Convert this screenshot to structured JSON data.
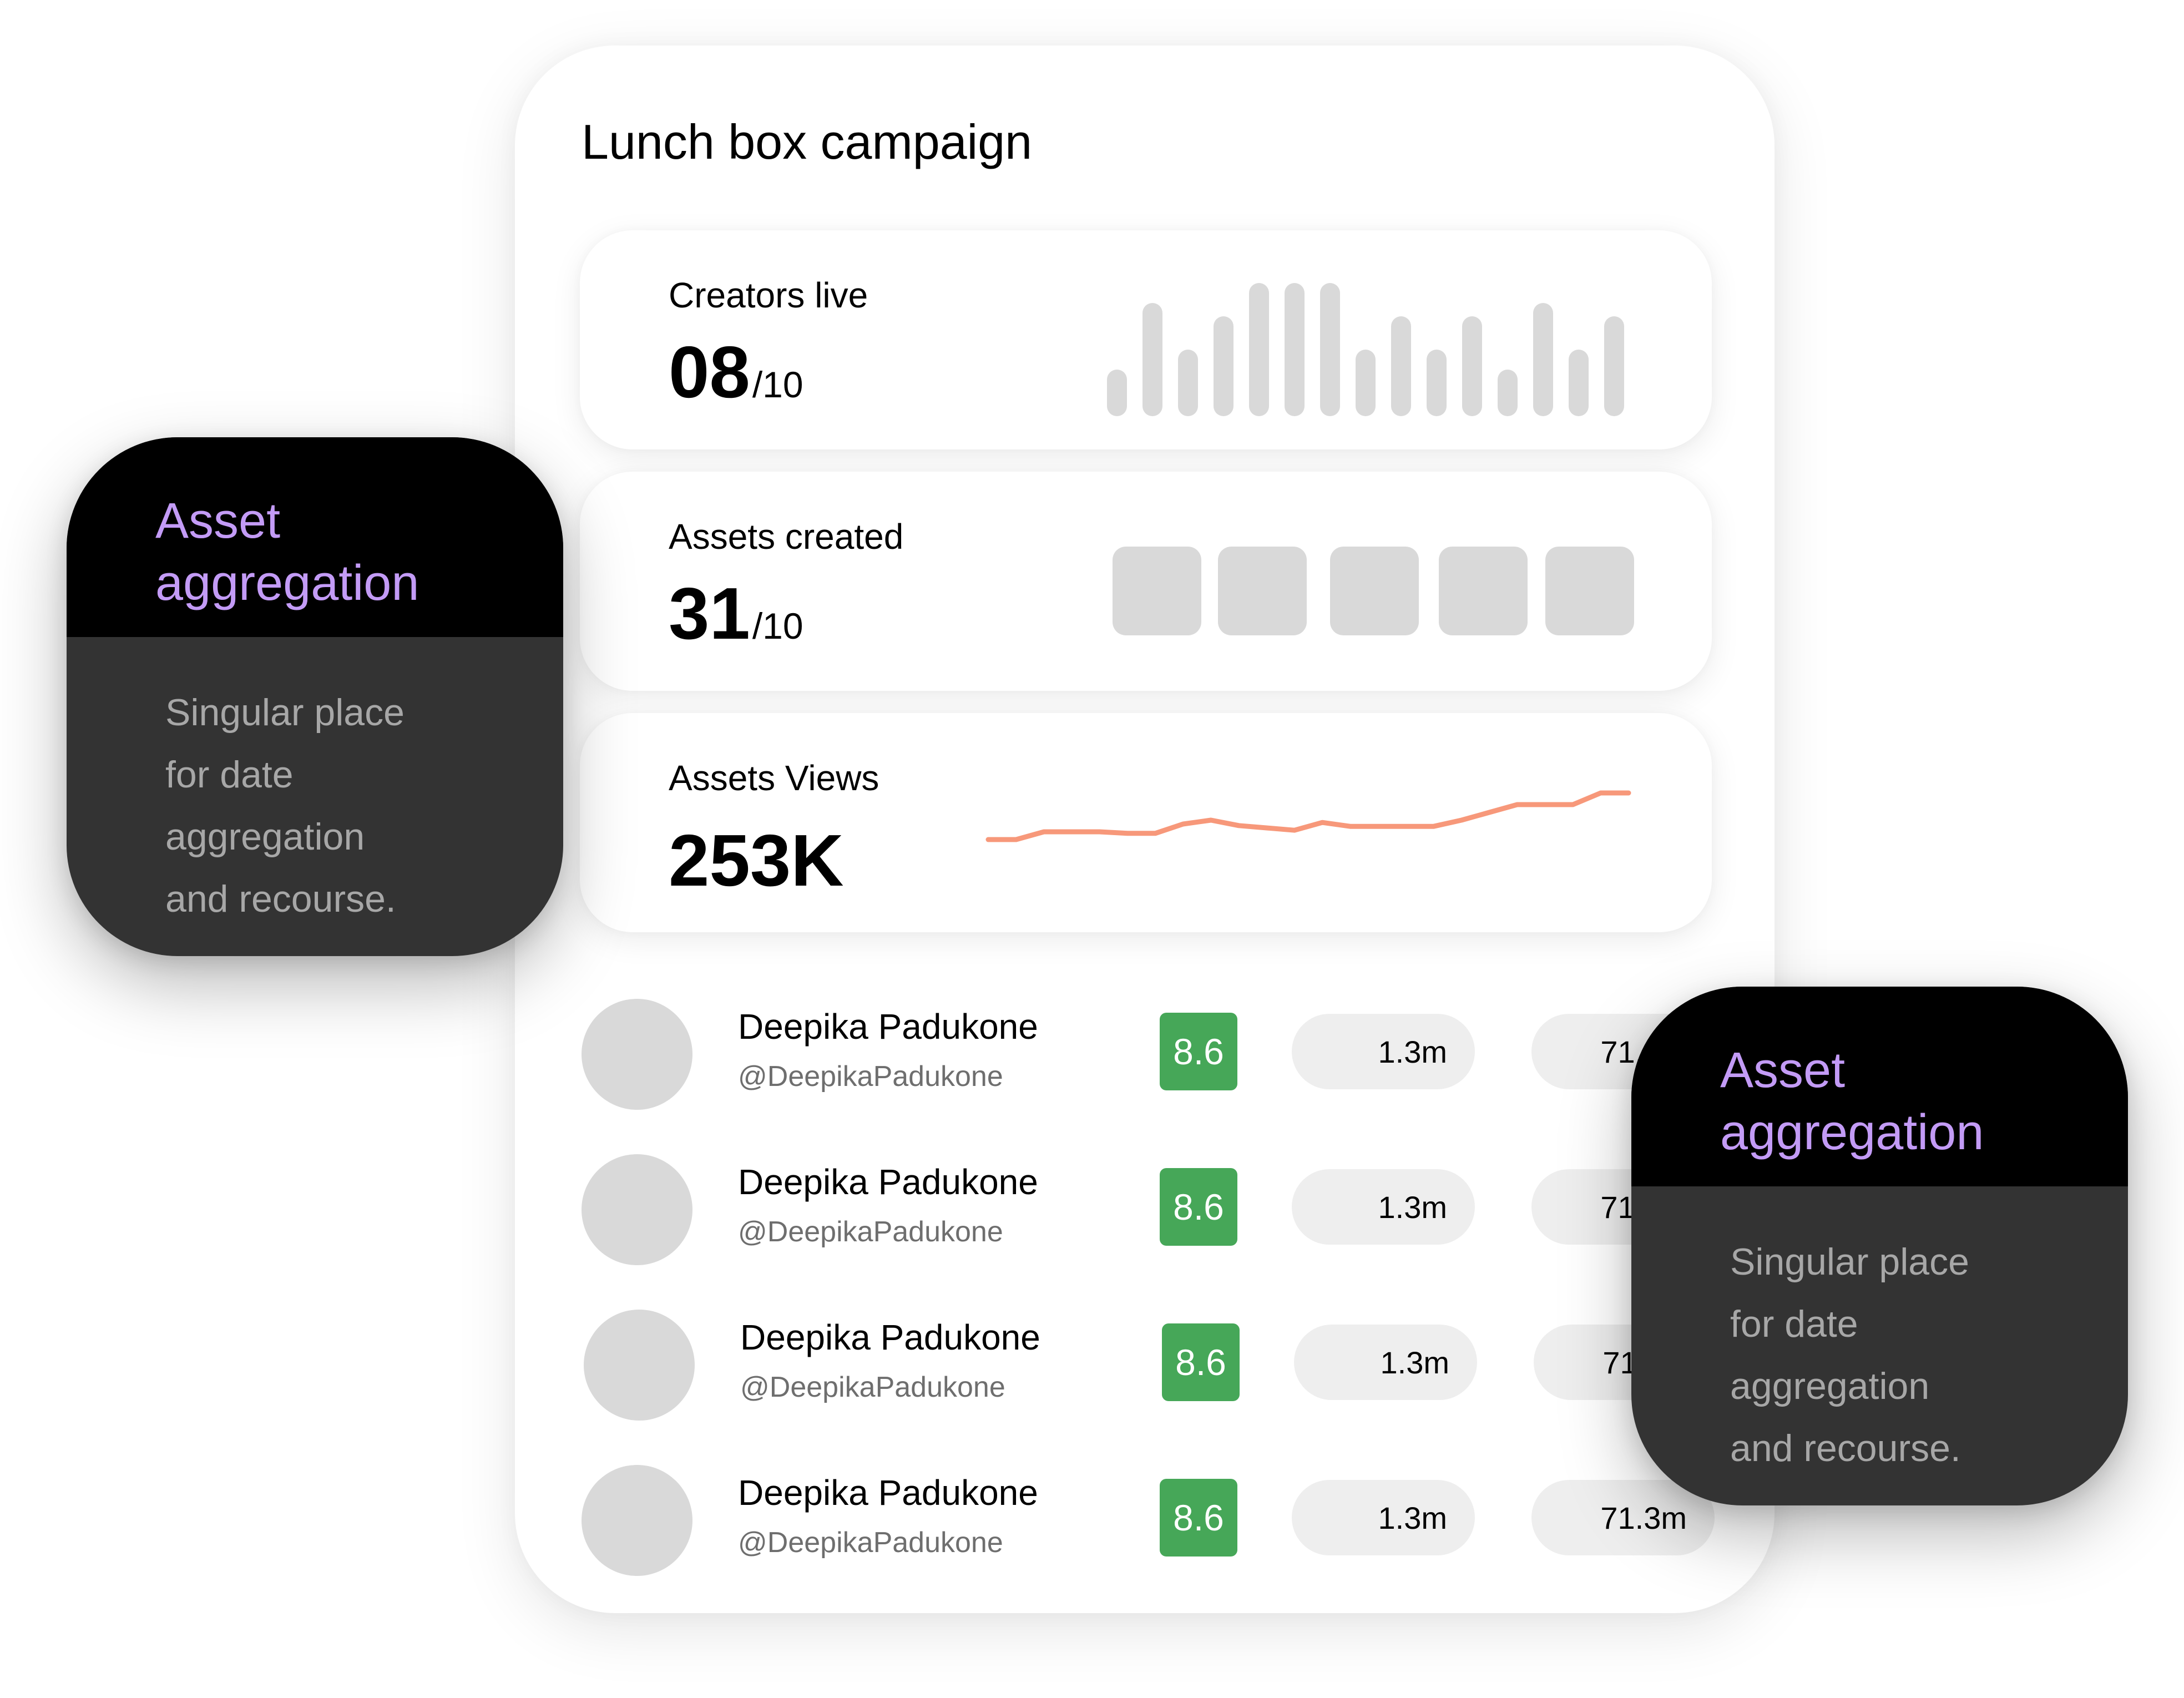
{
  "campaign": {
    "title": "Lunch box campaign"
  },
  "stats": {
    "creators": {
      "label": "Creators live",
      "value": "08",
      "suffix": "/10",
      "activity_bars": [
        0.35,
        0.85,
        0.5,
        0.75,
        1.0,
        1.0,
        1.0,
        0.5,
        0.75,
        0.5,
        0.75,
        0.35,
        0.85,
        0.5,
        0.75
      ]
    },
    "assets": {
      "label": "Assets created",
      "value": "31",
      "suffix": "/10",
      "thumbnail_count": 5
    },
    "views": {
      "label": "Assets Views",
      "value": "253K",
      "trend": [
        0.3,
        0.3,
        0.4,
        0.4,
        0.4,
        0.38,
        0.38,
        0.5,
        0.55,
        0.48,
        0.45,
        0.42,
        0.52,
        0.47,
        0.47,
        0.47,
        0.47,
        0.55,
        0.65,
        0.75,
        0.75,
        0.75,
        0.9,
        0.9
      ],
      "trend_color": "#f7987a"
    }
  },
  "creators": [
    {
      "name": "Deepika Padukone",
      "handle": "@DeepikaPadukone",
      "score": "8.6",
      "views": "1.3m",
      "total": "71.3m"
    },
    {
      "name": "Deepika Padukone",
      "handle": "@DeepikaPadukone",
      "score": "8.6",
      "views": "1.3m",
      "total": "71.3m"
    },
    {
      "name": "Deepika Padukone",
      "handle": "@DeepikaPadukone",
      "score": "8.6",
      "views": "1.3m",
      "total": "71.3m"
    },
    {
      "name": "Deepika Padukone",
      "handle": "@DeepikaPadukone",
      "score": "8.6",
      "views": "1.3m",
      "total": "71.3m"
    }
  ],
  "callouts": [
    {
      "title_line1": "Asset",
      "title_line2": "aggregation",
      "body": [
        "Singular place",
        "for date",
        "aggregation",
        "and recourse."
      ]
    },
    {
      "title_line1": "Asset",
      "title_line2": "aggregation",
      "body": [
        "Singular place",
        "for date",
        "aggregation",
        "and recourse."
      ]
    }
  ],
  "colors": {
    "accent": "#c39bf6",
    "score": "#46a758",
    "placeholder": "#d9d9d9"
  }
}
